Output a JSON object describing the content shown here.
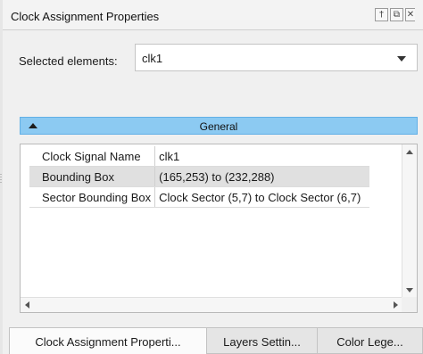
{
  "panel": {
    "title": "Clock Assignment Properties",
    "buttons": {
      "pin_icon": "pin-icon",
      "float_icon": "float-icon",
      "close_icon": "close-icon"
    }
  },
  "selection": {
    "label": "Selected elements:",
    "value": "clk1"
  },
  "group": {
    "label": "General",
    "expanded": true
  },
  "properties": [
    {
      "name": "Clock Signal Name",
      "value": "clk1"
    },
    {
      "name": "Bounding Box",
      "value": "(165,253) to (232,288)"
    },
    {
      "name": "Sector Bounding Box",
      "value": "Clock Sector (5,7) to Clock Sector (6,7)"
    }
  ],
  "tabs": [
    {
      "label": "Clock Assignment Properti...",
      "active": true
    },
    {
      "label": "Layers Settin...",
      "active": false
    },
    {
      "label": "Color Lege...",
      "active": false
    }
  ],
  "colors": {
    "group_header": "#8ccaf2",
    "selected_row": "#e0e0e0"
  }
}
